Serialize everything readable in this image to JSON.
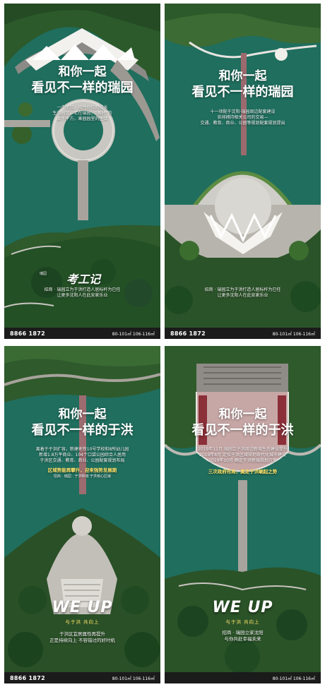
{
  "posters": [
    {
      "headline_line1": "和你一起",
      "headline_line2": "看见不一样的瑞园",
      "body_lines": [
        "一个学位，给性价位的成长",
        "生态园区，老在瑞园，“美好”的",
        "上千平方，乘园园里的生活"
      ],
      "brand": "考工记",
      "brand_sub": "瑞园",
      "bottom_lines": [
        "招商 · 瑞园立为于洪打造人居标杆为已任",
        "让更多沈阳人在此安家乐业"
      ],
      "phone": "8866 1872",
      "area": "80-101㎡  106-116㎡"
    },
    {
      "headline_line1": "和你一起",
      "headline_line2": "看见不一样的瑞园",
      "body_lines": [
        "十一项配于沈阳·瑞园周边配套建设",
        "安排拥持相关公司的交易—",
        "交通、教育、商业、公园等规划配套规划提出"
      ],
      "bottom_lines": [
        "招商 · 瑞园立为于洪打造人居标杆为已任",
        "让更多沈阳人在此安家乐业"
      ],
      "phone": "8866 1872",
      "area": "80-101㎡  106-116㎡"
    },
    {
      "headline_line1": "和你一起",
      "headline_line2": "看见不一样的于洪",
      "body_lines": [
        "离着于于洪扩容，新建地铁10号学校和8所幼儿园",
        "新增1.8万平商业、104个口袋公园综合人居用",
        "于洪区交通、教育、商业、公园配套规划布局"
      ],
      "highlight": "区域势能再攀升，迎来强势发展期",
      "small_line": "招商 · 瑞园 · 于洪新城  于洪核心区域",
      "weup": "WE UP",
      "weup_sub": "与于洪 共向上",
      "bottom_lines": [
        "于洪区宜居属性再提升",
        "正是持续向上 不容错过的好时机"
      ],
      "phone": "8866 1872",
      "area": "80-101㎡  106-116㎡"
    },
    {
      "headline_line1": "和你一起",
      "headline_line2": "看见不一样的于洪",
      "body_lines": [
        "2019年11月 瑞园立于洪周边新城生态建设提升",
        "2019年8月 定位于洪区域规划现代化城市建设",
        "2019年10月 确定于洪新城规划方案"
      ],
      "highlight": "三次政府布局，奠定于洪崛起之势",
      "weup": "WE UP",
      "weup_sub": "与于洪 共向上",
      "bottom_lines": [
        "招商 · 瑞园立家沈阳",
        "与你共赴幸福未来"
      ],
      "area": "80-101㎡  106-116㎡"
    }
  ],
  "colors": {
    "water": "#1f6e5e",
    "forest": "#2f5a2c",
    "plaza": "#c9c7c1",
    "highlight": "#ffe36a",
    "footer": "#1b1b1b"
  }
}
